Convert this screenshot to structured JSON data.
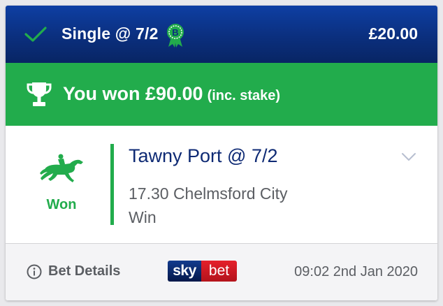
{
  "header": {
    "bet_type": "Single @ 7/2",
    "boost_badge_letter": "B",
    "stake": "£20.00",
    "icons": {
      "check": "check-icon",
      "boost": "boost-rosette-icon"
    },
    "colors": {
      "background": "#0b2f7e",
      "check": "#22ac4c",
      "boost": "#22ac4c"
    }
  },
  "result_banner": {
    "text": "You won £90.00",
    "suffix": "(inc. stake)",
    "icon": "trophy-icon",
    "color": "#22ac4c"
  },
  "selection": {
    "name": "Tawny Port @ 7/2",
    "race": "17.30 Chelmsford City",
    "market": "Win",
    "result": "Won",
    "icon": "horse-racing-icon",
    "result_color": "#22ac4c",
    "expand_icon": "chevron-down-icon"
  },
  "footer": {
    "details_label": "Bet Details",
    "logo": {
      "sky": "sky",
      "bet": "bet"
    },
    "timestamp": "09:02 2nd Jan 2020",
    "icon": "info-icon"
  }
}
